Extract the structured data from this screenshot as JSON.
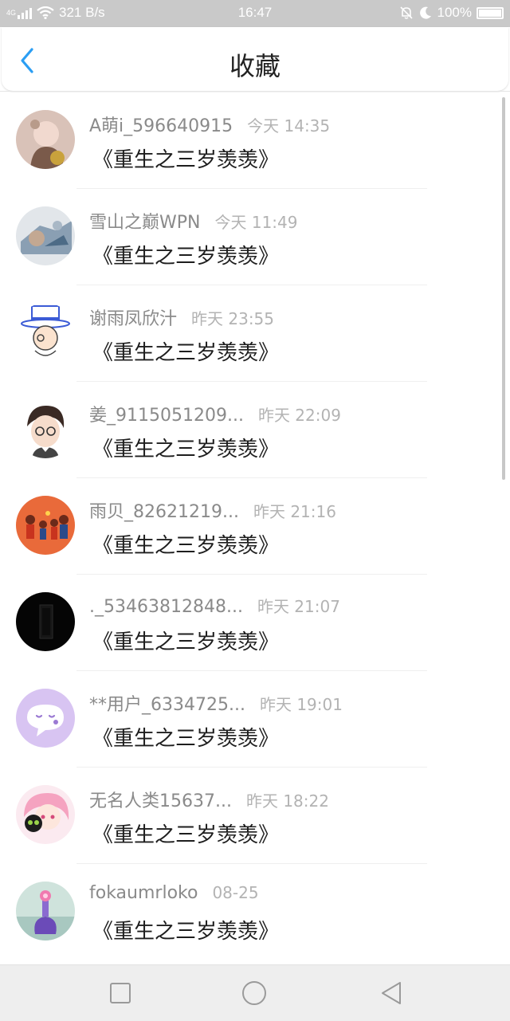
{
  "status_bar": {
    "network_type": "4G",
    "speed": "321 B/s",
    "time": "16:47",
    "battery": "100%",
    "icons": [
      "signal-icon",
      "wifi-icon",
      "bell-muted-icon",
      "moon-icon",
      "battery-icon"
    ]
  },
  "header": {
    "title": "收藏",
    "back_icon": "chevron-left-icon",
    "accent_color": "#2b9ef3"
  },
  "favorites": [
    {
      "user": "A萌i_596640915",
      "time": "今天 14:35",
      "book": "《重生之三岁羡羡》"
    },
    {
      "user": "雪山之巅WPN",
      "time": "今天 11:49",
      "book": "《重生之三岁羡羡》"
    },
    {
      "user": "谢雨凤欣汁",
      "time": "昨天 23:55",
      "book": "《重生之三岁羡羡》"
    },
    {
      "user": "姜_9115051209...",
      "time": "昨天 22:09",
      "book": "《重生之三岁羡羡》"
    },
    {
      "user": "雨贝_82621219...",
      "time": "昨天 21:16",
      "book": "《重生之三岁羡羡》"
    },
    {
      "user": "._53463812848...",
      "time": "昨天 21:07",
      "book": "《重生之三岁羡羡》"
    },
    {
      "user": "**用户_6334725...",
      "time": "昨天 19:01",
      "book": "《重生之三岁羡羡》"
    },
    {
      "user": "无名人类15637...",
      "time": "昨天 18:22",
      "book": "《重生之三岁羡羡》"
    },
    {
      "user": "fokaumrloko",
      "time": "08-25",
      "book": "《重生之三岁羡羡》"
    }
  ],
  "nav_bar": {
    "icons": [
      "square-icon",
      "circle-icon",
      "triangle-back-icon"
    ]
  }
}
